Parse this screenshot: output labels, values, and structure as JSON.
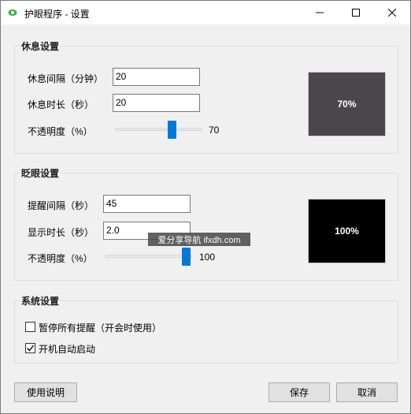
{
  "window": {
    "title": "护眼程序 - 设置",
    "accent_color": "#0078d7"
  },
  "rest_settings": {
    "group_title": "休息设置",
    "interval_label": "休息间隔（分钟）",
    "interval_value": "20",
    "duration_label": "休息时长（秒）",
    "duration_value": "20",
    "opacity_label": "不透明度（%）",
    "opacity_value": "70",
    "opacity_fraction": 0.7,
    "preview_text": "70%",
    "preview_color": "#4a474a"
  },
  "blink_settings": {
    "group_title": "眨眼设置",
    "interval_label": "提醒间隔（秒）",
    "interval_value": "45",
    "duration_label": "显示时长（秒）",
    "duration_value": "2.0",
    "opacity_label": "不透明度（%）",
    "opacity_value": "100",
    "opacity_fraction": 1.0,
    "preview_text": "100%",
    "preview_color": "#000000"
  },
  "system_settings": {
    "group_title": "系统设置",
    "pause_label": "暂停所有提醒（开会时使用）",
    "pause_checked": false,
    "autostart_label": "开机自动启动",
    "autostart_checked": true
  },
  "footer": {
    "help_label": "使用说明",
    "save_label": "保存",
    "cancel_label": "取消"
  },
  "overlay": {
    "watermark_text": "爱分享导航 ifxdh.com"
  }
}
